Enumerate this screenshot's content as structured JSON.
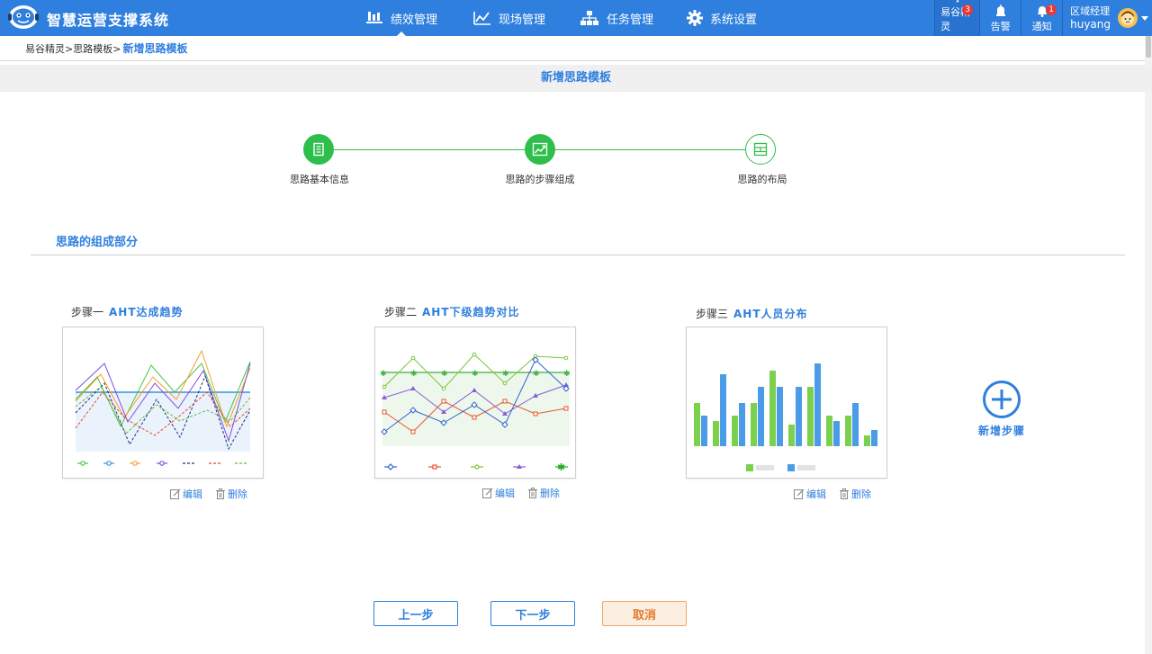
{
  "header": {
    "app_title": "智慧运营支撑系统",
    "nav": [
      {
        "label": "绩效管理",
        "icon": "performance-icon",
        "active": true
      },
      {
        "label": "现场管理",
        "icon": "chart-icon"
      },
      {
        "label": "任务管理",
        "icon": "org-tree-icon"
      },
      {
        "label": "系统设置",
        "icon": "gear-icon"
      }
    ],
    "tools": [
      {
        "label": "易谷精灵",
        "badge": "3",
        "icon": "chat-icon"
      },
      {
        "label": "告警",
        "icon": "alarm-icon"
      },
      {
        "label": "通知",
        "badge": "1",
        "icon": "bell-icon"
      }
    ],
    "user": {
      "role": "区域经理",
      "name": "huyang"
    }
  },
  "breadcrumb": {
    "path": "易谷精灵>思路模板>",
    "current": "新增思路模板"
  },
  "page_title": "新增思路模板",
  "stepper": [
    {
      "label": "思路基本信息",
      "icon": "document-icon",
      "state": "done"
    },
    {
      "label": "思路的步骤组成",
      "icon": "trend-icon",
      "state": "done"
    },
    {
      "label": "思路的布局",
      "icon": "layout-icon",
      "state": "pending"
    }
  ],
  "section_title": "思路的组成部分",
  "steps": [
    {
      "step": "步骤一",
      "name": "AHT达成趋势",
      "edit": "编辑",
      "delete": "删除"
    },
    {
      "step": "步骤二",
      "name": "AHT下级趋势对比",
      "edit": "编辑",
      "delete": "删除"
    },
    {
      "step": "步骤三",
      "name": "AHT人员分布",
      "edit": "编辑",
      "delete": "删除"
    }
  ],
  "add_step_label": "新增步骤",
  "buttons": {
    "prev": "上一步",
    "next": "下一步",
    "cancel": "取消"
  },
  "colors": {
    "primary": "#2f7fde",
    "success": "#2dbe4c",
    "cancel_text": "#e07b2c",
    "badge": "#e83a33"
  }
}
